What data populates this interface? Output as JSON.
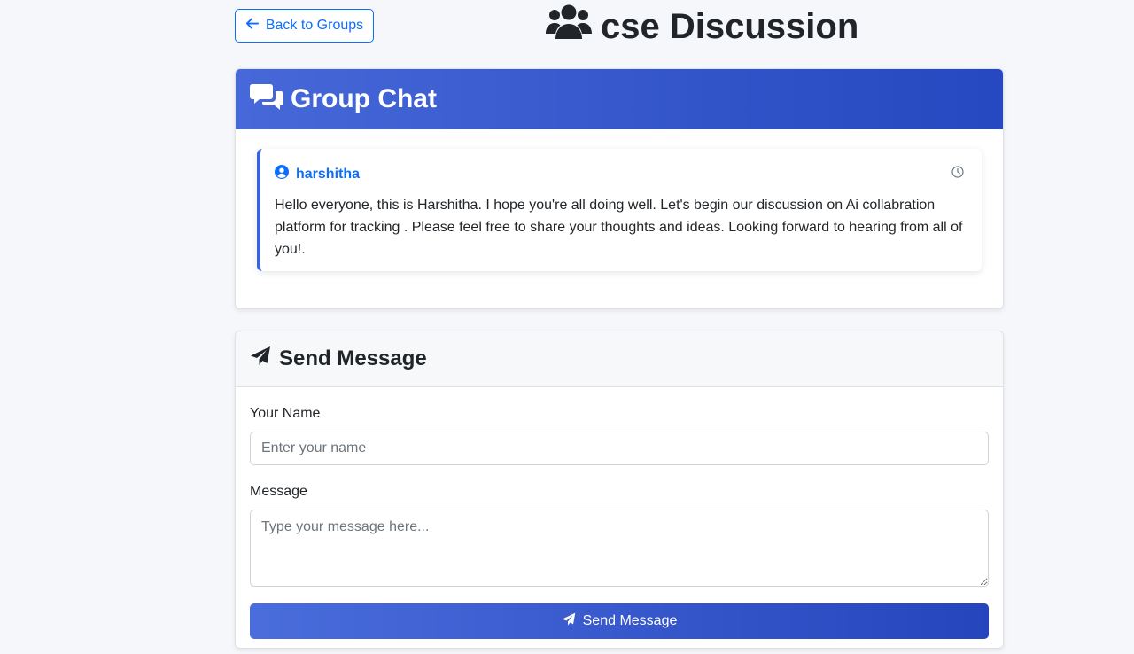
{
  "top_bar": {
    "back_label": "Back to Groups",
    "page_title": "cse Discussion"
  },
  "chat": {
    "header_title": "Group Chat",
    "messages": [
      {
        "user": "harshitha",
        "text": "Hello everyone, this is Harshitha. I hope you're all doing well. Let's begin our discussion on Ai collabration platform for tracking . Please feel free to share your thoughts and ideas. Looking forward to hearing from all of you!."
      }
    ]
  },
  "send_form": {
    "header_title": "Send Message",
    "name_label": "Your Name",
    "name_placeholder": "Enter your name",
    "name_value": "",
    "message_label": "Message",
    "message_placeholder": "Type your message here...",
    "message_value": "",
    "submit_label": "Send Message"
  },
  "colors": {
    "primary": "#0d6efd",
    "header_gradient_start": "#4668d8",
    "header_gradient_end": "#2648c0",
    "page_background": "#f5f7fb"
  },
  "icons": {
    "back": "arrow-left-icon",
    "title": "users-icon",
    "chat_header": "comments-icon",
    "message_user": "user-circle-icon",
    "message_time": "clock-icon",
    "send_header": "paper-plane-icon",
    "submit": "paper-plane-icon"
  }
}
